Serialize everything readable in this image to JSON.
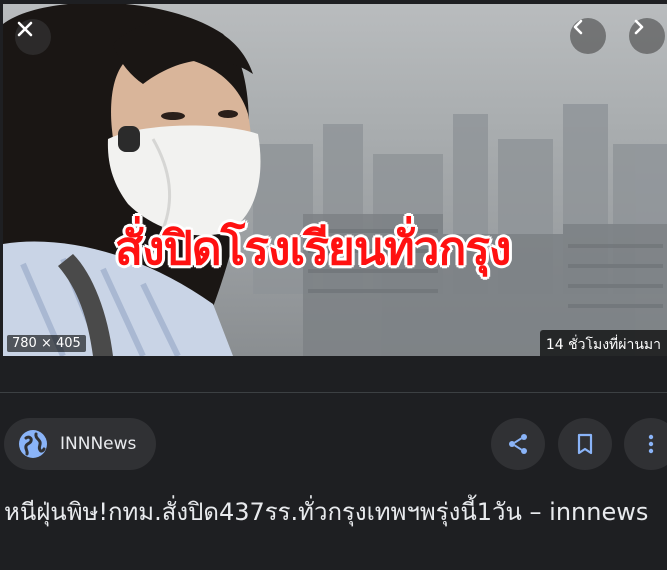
{
  "image": {
    "headline": "สั่งปิดโรงเรียนทั่วกรุง",
    "dimensions": "780 × 405",
    "age": "14 ชั่วโมงที่ผ่านมา"
  },
  "controls": {
    "close_icon": "close-icon",
    "prev_icon": "chevron-left-icon",
    "next_icon": "chevron-right-icon"
  },
  "source": {
    "name": "INNNews",
    "icon": "globe-icon",
    "icon_color": "#8ab4f8"
  },
  "actions": [
    {
      "icon": "share-icon",
      "color": "#8ab4f8"
    },
    {
      "icon": "bookmark-icon",
      "color": "#8ab4f8"
    },
    {
      "icon": "more-vert-icon",
      "color": "#8ab4f8"
    }
  ],
  "result": {
    "title": "หนีฝุ่นพิษ!กทม.สั่งปิด437รร.ทั่วกรุงเทพฯพรุ่งนี้1วัน – innnews"
  }
}
